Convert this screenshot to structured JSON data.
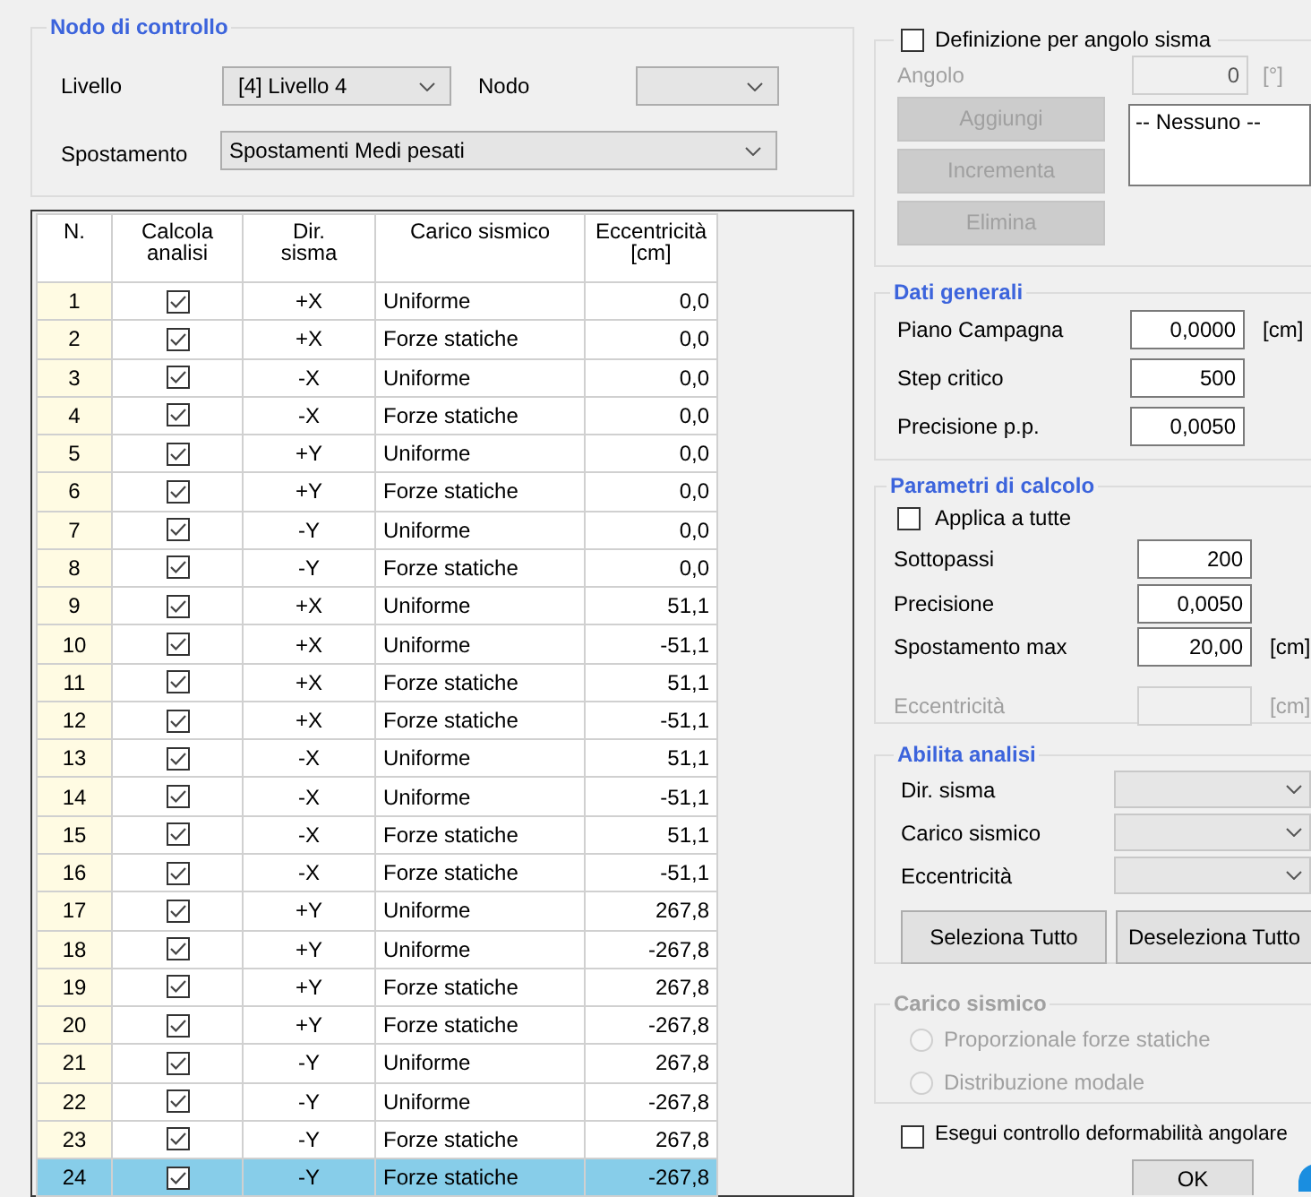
{
  "nodo_di_controllo": {
    "title": "Nodo di controllo",
    "livello": {
      "label": "Livello",
      "value": "[4]  Livello 4"
    },
    "nodo": {
      "label": "Nodo"
    },
    "spostamento": {
      "label": "Spostamento",
      "value": "Spostamenti Medi pesati"
    }
  },
  "table": {
    "columns": [
      "N.",
      "Calcola\nanalisi",
      "Dir.\nsisma",
      "Carico sismico",
      "Eccentricità\n[cm]"
    ],
    "rows": [
      {
        "n": "1",
        "calcola_analisi": true,
        "dir_sisma": "+X",
        "carico_sismico": "Uniforme",
        "eccentricita": "0,0",
        "selected": false
      },
      {
        "n": "2",
        "calcola_analisi": true,
        "dir_sisma": "+X",
        "carico_sismico": "Forze statiche",
        "eccentricita": "0,0",
        "selected": false
      },
      {
        "n": "3",
        "calcola_analisi": true,
        "dir_sisma": "-X",
        "carico_sismico": "Uniforme",
        "eccentricita": "0,0",
        "selected": false
      },
      {
        "n": "4",
        "calcola_analisi": true,
        "dir_sisma": "-X",
        "carico_sismico": "Forze statiche",
        "eccentricita": "0,0",
        "selected": false
      },
      {
        "n": "5",
        "calcola_analisi": true,
        "dir_sisma": "+Y",
        "carico_sismico": "Uniforme",
        "eccentricita": "0,0",
        "selected": false
      },
      {
        "n": "6",
        "calcola_analisi": true,
        "dir_sisma": "+Y",
        "carico_sismico": "Forze statiche",
        "eccentricita": "0,0",
        "selected": false
      },
      {
        "n": "7",
        "calcola_analisi": true,
        "dir_sisma": "-Y",
        "carico_sismico": "Uniforme",
        "eccentricita": "0,0",
        "selected": false
      },
      {
        "n": "8",
        "calcola_analisi": true,
        "dir_sisma": "-Y",
        "carico_sismico": "Forze statiche",
        "eccentricita": "0,0",
        "selected": false
      },
      {
        "n": "9",
        "calcola_analisi": true,
        "dir_sisma": "+X",
        "carico_sismico": "Uniforme",
        "eccentricita": "51,1",
        "selected": false
      },
      {
        "n": "10",
        "calcola_analisi": true,
        "dir_sisma": "+X",
        "carico_sismico": "Uniforme",
        "eccentricita": "-51,1",
        "selected": false
      },
      {
        "n": "11",
        "calcola_analisi": true,
        "dir_sisma": "+X",
        "carico_sismico": "Forze statiche",
        "eccentricita": "51,1",
        "selected": false
      },
      {
        "n": "12",
        "calcola_analisi": true,
        "dir_sisma": "+X",
        "carico_sismico": "Forze statiche",
        "eccentricita": "-51,1",
        "selected": false
      },
      {
        "n": "13",
        "calcola_analisi": true,
        "dir_sisma": "-X",
        "carico_sismico": "Uniforme",
        "eccentricita": "51,1",
        "selected": false
      },
      {
        "n": "14",
        "calcola_analisi": true,
        "dir_sisma": "-X",
        "carico_sismico": "Uniforme",
        "eccentricita": "-51,1",
        "selected": false
      },
      {
        "n": "15",
        "calcola_analisi": true,
        "dir_sisma": "-X",
        "carico_sismico": "Forze statiche",
        "eccentricita": "51,1",
        "selected": false
      },
      {
        "n": "16",
        "calcola_analisi": true,
        "dir_sisma": "-X",
        "carico_sismico": "Forze statiche",
        "eccentricita": "-51,1",
        "selected": false
      },
      {
        "n": "17",
        "calcola_analisi": true,
        "dir_sisma": "+Y",
        "carico_sismico": "Uniforme",
        "eccentricita": "267,8",
        "selected": false
      },
      {
        "n": "18",
        "calcola_analisi": true,
        "dir_sisma": "+Y",
        "carico_sismico": "Uniforme",
        "eccentricita": "-267,8",
        "selected": false
      },
      {
        "n": "19",
        "calcola_analisi": true,
        "dir_sisma": "+Y",
        "carico_sismico": "Forze statiche",
        "eccentricita": "267,8",
        "selected": false
      },
      {
        "n": "20",
        "calcola_analisi": true,
        "dir_sisma": "+Y",
        "carico_sismico": "Forze statiche",
        "eccentricita": "-267,8",
        "selected": false
      },
      {
        "n": "21",
        "calcola_analisi": true,
        "dir_sisma": "-Y",
        "carico_sismico": "Uniforme",
        "eccentricita": "267,8",
        "selected": false
      },
      {
        "n": "22",
        "calcola_analisi": true,
        "dir_sisma": "-Y",
        "carico_sismico": "Uniforme",
        "eccentricita": "-267,8",
        "selected": false
      },
      {
        "n": "23",
        "calcola_analisi": true,
        "dir_sisma": "-Y",
        "carico_sismico": "Forze statiche",
        "eccentricita": "267,8",
        "selected": false
      },
      {
        "n": "24",
        "calcola_analisi": true,
        "dir_sisma": "-Y",
        "carico_sismico": "Forze statiche",
        "eccentricita": "-267,8",
        "selected": true
      }
    ]
  },
  "angolo_sisma": {
    "label": "Definizione per angolo sisma",
    "checked": false,
    "angolo": {
      "label": "Angolo",
      "value": "0",
      "unit": "[°]",
      "disabled": true
    },
    "buttons": [
      {
        "label": "Aggiungi",
        "disabled": true
      },
      {
        "label": "Incrementa",
        "disabled": true
      },
      {
        "label": "Elimina",
        "disabled": true
      }
    ],
    "list": [
      "-- Nessuno --"
    ]
  },
  "dati_generali": {
    "title": "Dati generali",
    "fields": [
      {
        "label": "Piano Campagna",
        "value": "0,0000",
        "unit": "[cm]"
      },
      {
        "label": "Step critico",
        "value": "500"
      },
      {
        "label": "Precisione p.p.",
        "value": "0,0050"
      }
    ]
  },
  "parametri_di_calcolo": {
    "title": "Parametri di calcolo",
    "applica_a_tutte": {
      "label": "Applica a tutte",
      "checked": false
    },
    "fields": [
      {
        "label": "Sottopassi",
        "value": "200",
        "disabled": false
      },
      {
        "label": "Precisione",
        "value": "0,0050",
        "disabled": false
      },
      {
        "label": "Spostamento max",
        "value": "20,00",
        "unit": "[cm]",
        "disabled": false
      },
      {
        "label": "Eccentricità",
        "unit": "[cm]",
        "disabled": true
      }
    ]
  },
  "abilita_analisi": {
    "title": "Abilita analisi",
    "dropdowns": [
      {
        "label": "Dir. sisma"
      },
      {
        "label": "Carico sismico"
      },
      {
        "label": "Eccentricità"
      }
    ],
    "buttons": [
      "Seleziona Tutto",
      "Deseleziona Tutto"
    ]
  },
  "carico_sismico": {
    "title": "Carico sismico",
    "disabled": true,
    "options": [
      {
        "label": "Proporzionale forze statiche",
        "selected": false
      },
      {
        "label": "Distribuzione modale",
        "selected": false
      }
    ]
  },
  "controllo_deformabilita": {
    "label": "Esegui controllo deformabilità angolare",
    "checked": false
  },
  "buttons": [
    "OK"
  ]
}
